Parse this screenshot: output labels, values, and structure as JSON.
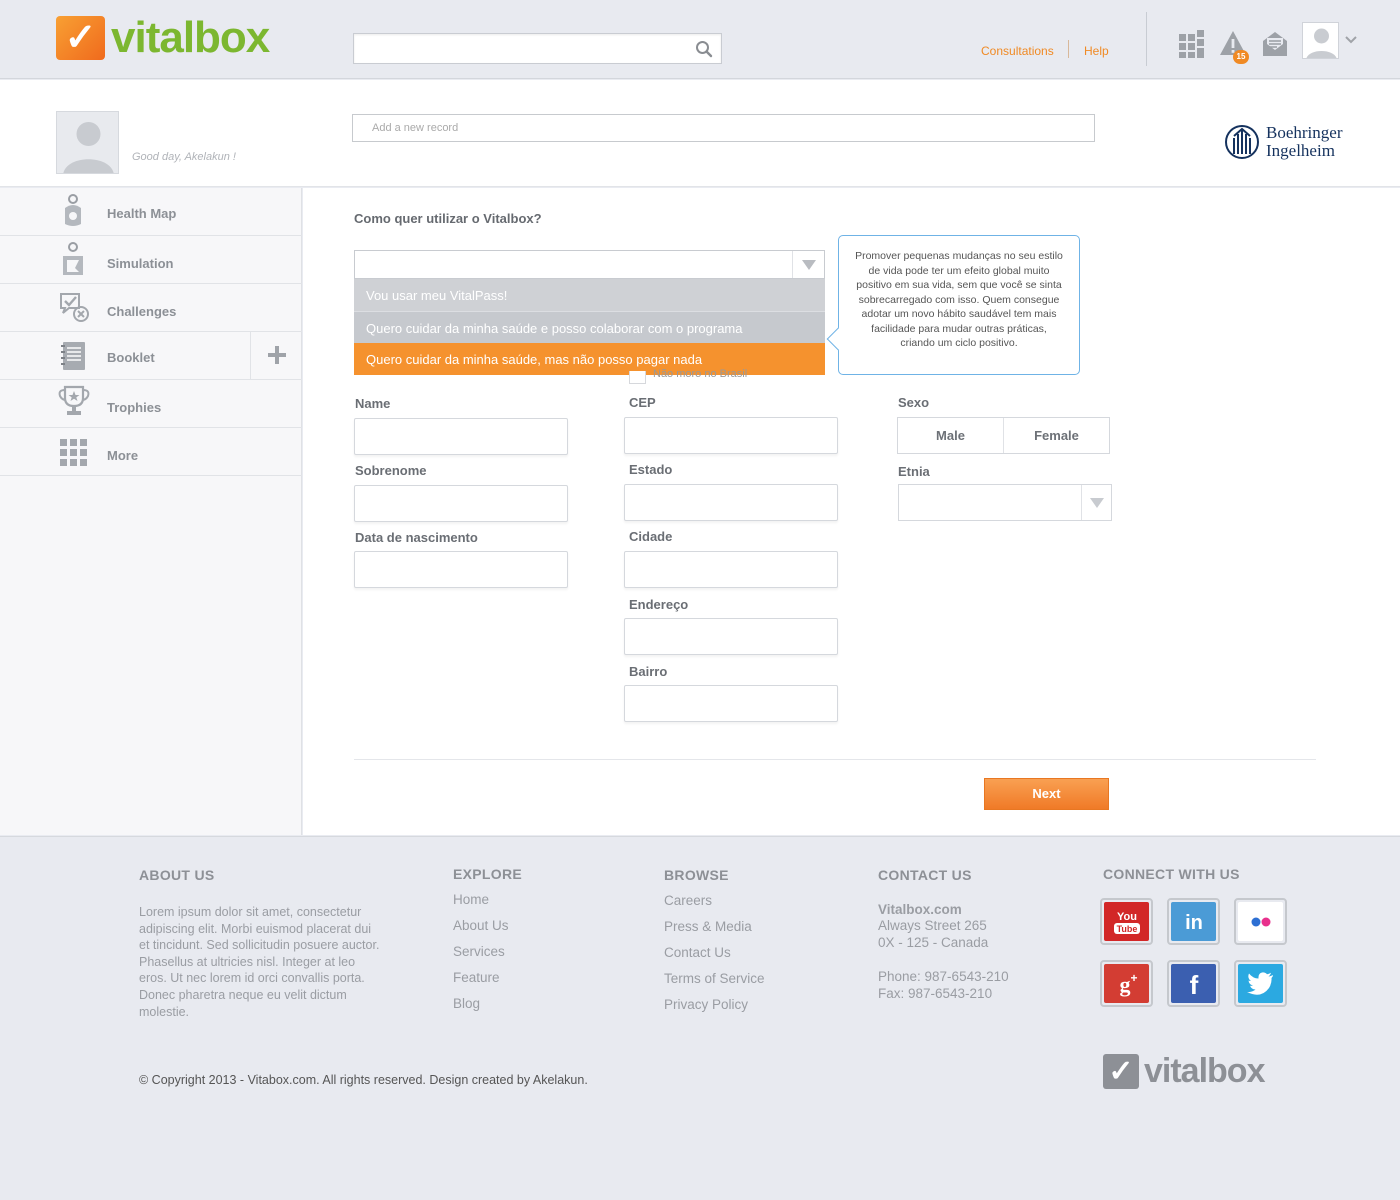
{
  "brand": {
    "name": "vitalbox",
    "accent": "#f5922e",
    "green": "#7cb730"
  },
  "header": {
    "search": {
      "value": "",
      "placeholder": ""
    },
    "links": {
      "consultations": "Consultations",
      "help": "Help"
    },
    "notifications_count": "15"
  },
  "profile": {
    "greeting": "Good day, Akelakun !",
    "add_record_placeholder": "Add a new record",
    "partner": {
      "line1": "Boehringer",
      "line2": "Ingelheim"
    }
  },
  "sidebar": {
    "items": [
      {
        "label": "Health Map",
        "icon": "health-map-icon"
      },
      {
        "label": "Simulation",
        "icon": "simulation-icon"
      },
      {
        "label": "Challenges",
        "icon": "challenges-icon"
      },
      {
        "label": "Booklet",
        "icon": "booklet-icon"
      },
      {
        "label": "Trophies",
        "icon": "trophy-icon"
      },
      {
        "label": "More",
        "icon": "grid-icon"
      }
    ]
  },
  "form": {
    "question": "Como quer utilizar o Vitalbox?",
    "usage_select": {
      "value": "",
      "options": [
        "Vou usar meu VitalPass!",
        "Quero cuidar da minha saúde e posso colaborar com o programa",
        "Quero cuidar da minha saúde, mas não posso pagar nada"
      ],
      "highlighted_index": 2
    },
    "tooltip": "Promover pequenas mudanças no seu estilo de vida pode ter um efeito global muito positivo em sua vida, sem que você se sinta sobrecarregado com isso. Quem consegue adotar um novo hábito saudável tem mais facilidade para mudar outras práticas, criando um ciclo positivo.",
    "no_brazil_label": "Não moro no Brasil",
    "labels": {
      "name": "Name",
      "surname": "Sobrenome",
      "birth": "Data de nascimento",
      "cep": "CEP",
      "state": "Estado",
      "city": "Cidade",
      "address": "Endereço",
      "district": "Bairro",
      "sex": "Sexo",
      "ethnicity": "Etnia"
    },
    "sex_options": {
      "male": "Male",
      "female": "Female"
    },
    "next": "Next"
  },
  "footer": {
    "about": {
      "heading": "ABOUT US",
      "text": "Lorem ipsum dolor sit amet, consectetur adipiscing elit. Morbi euismod placerat dui et tincidunt. Sed sollicitudin posuere auctor. Phasellus at ultricies nisl. Integer at leo eros. Ut nec lorem id orci convallis porta. Donec pharetra neque eu velit dictum molestie."
    },
    "explore": {
      "heading": "EXPLORE",
      "links": [
        "Home",
        "About Us",
        "Services",
        "Feature",
        "Blog"
      ]
    },
    "browse": {
      "heading": "BROWSE",
      "links": [
        "Careers",
        "Press & Media",
        "Contact Us",
        "Terms of Service",
        "Privacy Policy"
      ]
    },
    "contact": {
      "heading": "CONTACT US",
      "company": "Vitalbox.com",
      "street": "Always Street 265",
      "city": "0X - 125 - Canada",
      "phone": "Phone: 987-6543-210",
      "fax": "Fax: 987-6543-210"
    },
    "connect": {
      "heading": "CONNECT WITH US",
      "networks": [
        {
          "name": "YouTube",
          "icon": "youtube-icon",
          "color": "#d22727"
        },
        {
          "name": "LinkedIn",
          "icon": "linkedin-icon",
          "color": "#4b9bd6"
        },
        {
          "name": "Flickr",
          "icon": "flickr-icon",
          "color": "#ffffff"
        },
        {
          "name": "Google+",
          "icon": "google-plus-icon",
          "color": "#d33d33"
        },
        {
          "name": "Facebook",
          "icon": "facebook-icon",
          "color": "#3b5fb0"
        },
        {
          "name": "Twitter",
          "icon": "twitter-icon",
          "color": "#2ba9e1"
        }
      ]
    },
    "copyright": "© Copyright 2013 - Vitabox.com. All rights reserved. Design created by Akelakun."
  }
}
